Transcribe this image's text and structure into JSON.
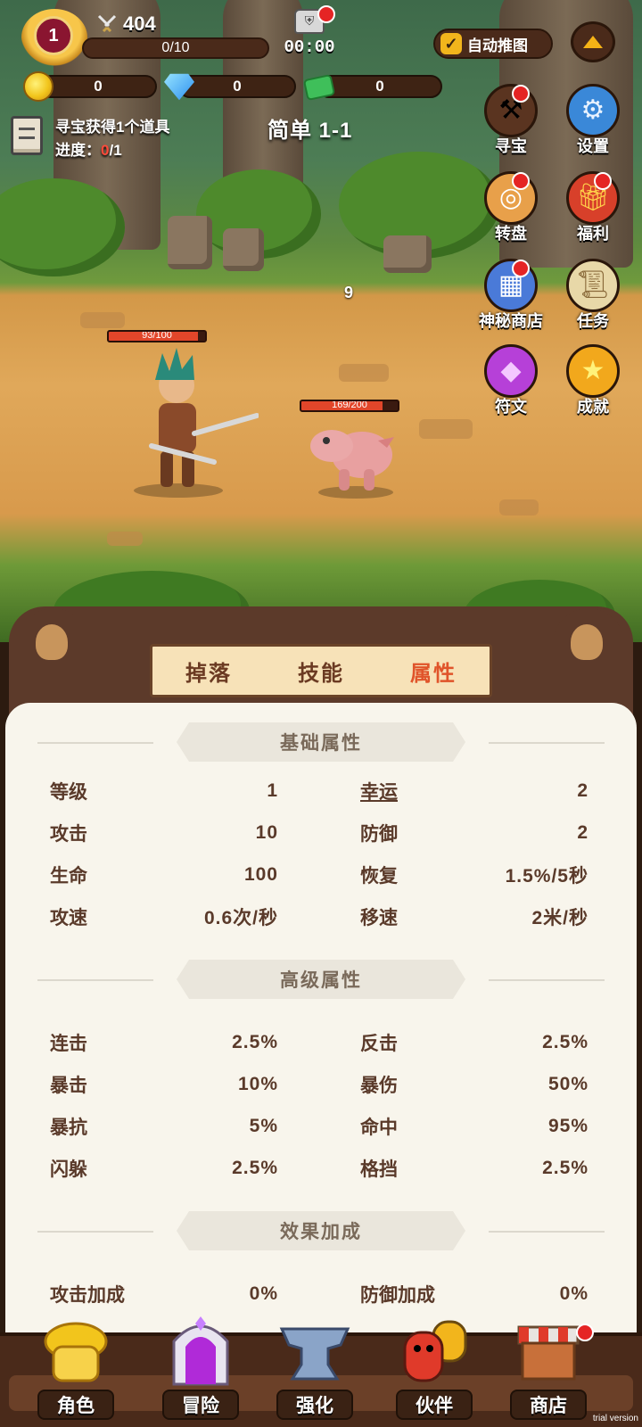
{
  "hud": {
    "level": "1",
    "power": "404",
    "xp": "0/10",
    "timer": "00:00",
    "auto_label": "自动推图",
    "coins": "0",
    "gems": "0",
    "cash": "0"
  },
  "quest": {
    "text": "寻宝获得1个道具",
    "progress_label": "进度：",
    "progress_current": "0",
    "progress_total": "/1"
  },
  "stage": {
    "title": "简单 1-1"
  },
  "side_buttons": [
    "寻宝",
    "设置",
    "转盘",
    "福利",
    "神秘商店",
    "任务",
    "符文",
    "成就"
  ],
  "battle": {
    "combo": "9",
    "hero_hp_text": "93/100",
    "hero_hp_fraction": 0.93,
    "enemy_hp_text": "169/200",
    "enemy_hp_fraction": 0.845
  },
  "tabs": [
    "掉落",
    "技能",
    "属性"
  ],
  "sections": {
    "basic": {
      "title": "基础属性",
      "rows": [
        {
          "l_name": "等级",
          "l_val": "1",
          "r_name": "幸运",
          "r_val": "2"
        },
        {
          "l_name": "攻击",
          "l_val": "10",
          "r_name": "防御",
          "r_val": "2"
        },
        {
          "l_name": "生命",
          "l_val": "100",
          "r_name": "恢复",
          "r_val": "1.5%/5秒"
        },
        {
          "l_name": "攻速",
          "l_val": "0.6次/秒",
          "r_name": "移速",
          "r_val": "2米/秒"
        }
      ]
    },
    "advanced": {
      "title": "高级属性",
      "rows": [
        {
          "l_name": "连击",
          "l_val": "2.5%",
          "r_name": "反击",
          "r_val": "2.5%"
        },
        {
          "l_name": "暴击",
          "l_val": "10%",
          "r_name": "暴伤",
          "r_val": "50%"
        },
        {
          "l_name": "暴抗",
          "l_val": "5%",
          "r_name": "命中",
          "r_val": "95%"
        },
        {
          "l_name": "闪躲",
          "l_val": "2.5%",
          "r_name": "格挡",
          "r_val": "2.5%"
        }
      ]
    },
    "bonus": {
      "title": "效果加成",
      "rows": [
        {
          "l_name": "攻击加成",
          "l_val": "0%",
          "r_name": "防御加成",
          "r_val": "0%"
        }
      ]
    }
  },
  "nav": [
    "角色",
    "冒险",
    "强化",
    "伙伴",
    "商店"
  ],
  "watermark": "trial version"
}
